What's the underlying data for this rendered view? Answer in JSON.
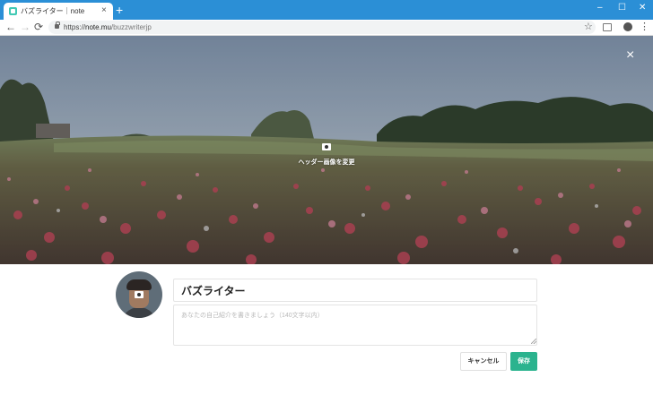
{
  "browser": {
    "tab_title": "バズライター｜note",
    "tab_close_glyph": "×",
    "new_tab_glyph": "+",
    "window_controls": {
      "minimize": "–",
      "maximize": "☐",
      "close": "✕"
    },
    "nav": {
      "back": "←",
      "forward": "→",
      "reload": "⟳"
    },
    "url_scheme": "https://",
    "url_host": "note.mu",
    "url_path": "/buzzwriterjp",
    "star_glyph": "☆",
    "menu_glyph": "⋮"
  },
  "header": {
    "close_glyph": "×",
    "change_label": "ヘッダー画像を変更"
  },
  "profile": {
    "name": "バズライター",
    "bio_value": "",
    "bio_placeholder": "あなたの自己紹介を書きましょう（140文字以内）",
    "cancel_label": "キャンセル",
    "save_label": "保存"
  },
  "colors": {
    "titlebar": "#2b8fd6",
    "accent": "#2bb38e",
    "favicon": "#41c9b4"
  },
  "icons": [
    "note-favicon-icon",
    "lock-icon",
    "star-icon",
    "extension-icon",
    "profile-icon",
    "menu-icon",
    "camera-icon",
    "close-icon"
  ]
}
